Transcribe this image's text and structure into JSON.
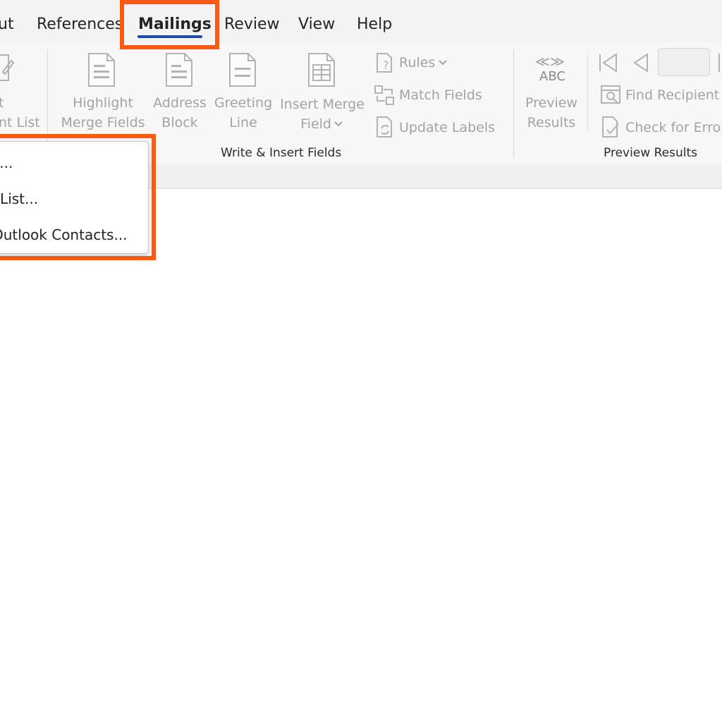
{
  "tabs": [
    {
      "label": "ut"
    },
    {
      "label": "References"
    },
    {
      "label": "Mailings"
    },
    {
      "label": "Review"
    },
    {
      "label": "View"
    },
    {
      "label": "Help"
    }
  ],
  "ribbon": {
    "start_partial": {
      "line1": "t",
      "line2": "nt List"
    },
    "highlight": {
      "line1": "Highlight",
      "line2": "Merge Fields"
    },
    "address": {
      "line1": "Address",
      "line2": "Block"
    },
    "greeting": {
      "line1": "Greeting",
      "line2": "Line"
    },
    "insert_merge": {
      "line1": "Insert Merge",
      "line2": "Field"
    },
    "rules": "Rules",
    "match_fields": "Match Fields",
    "update_labels": "Update Labels",
    "group_write_insert": "Write & Insert Fields",
    "preview": {
      "abc": "ABC",
      "line1": "Preview",
      "line2": "Results"
    },
    "find_recipient": "Find Recipient",
    "check_errors": "Check for Errors",
    "group_preview": "Preview Results"
  },
  "dropdown": {
    "items": [
      "st...",
      "g List...",
      "Outlook Contacts..."
    ]
  },
  "colors": {
    "accent_underline": "#1f4aa8",
    "highlight": "#fb5a14"
  }
}
